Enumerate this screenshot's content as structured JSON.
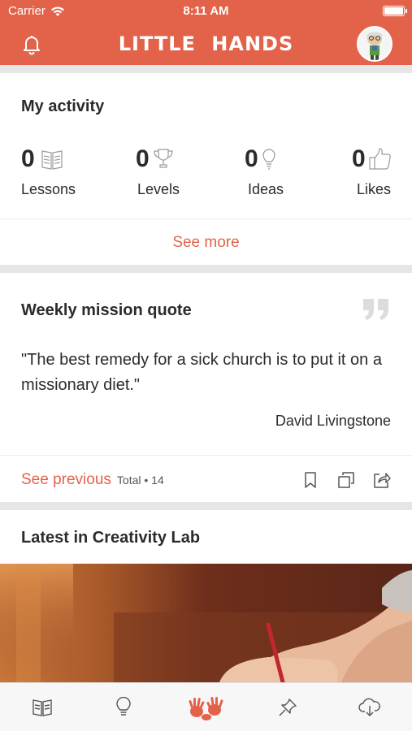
{
  "status_bar": {
    "carrier": "Carrier",
    "time": "8:11 AM"
  },
  "header": {
    "title": "LITTLE HANDS",
    "color": "#e3634a"
  },
  "activity": {
    "title": "My activity",
    "stats": [
      {
        "value": "0",
        "label": "Lessons",
        "icon": "book-icon"
      },
      {
        "value": "0",
        "label": "Levels",
        "icon": "trophy-icon"
      },
      {
        "value": "0",
        "label": "Ideas",
        "icon": "lightbulb-icon"
      },
      {
        "value": "0",
        "label": "Likes",
        "icon": "thumbs-up-icon"
      }
    ],
    "see_more": "See more"
  },
  "quote": {
    "title": "Weekly mission quote",
    "text": "\"The best remedy for a sick church is to put it on a missionary diet.\"",
    "author": "David Livingstone",
    "see_previous": "See previous",
    "total": "Total • 14"
  },
  "creativity": {
    "title": "Latest in Creativity Lab"
  },
  "tabs": [
    "book-icon",
    "lightbulb-icon",
    "hands-icon",
    "pin-icon",
    "cloud-download-icon"
  ]
}
